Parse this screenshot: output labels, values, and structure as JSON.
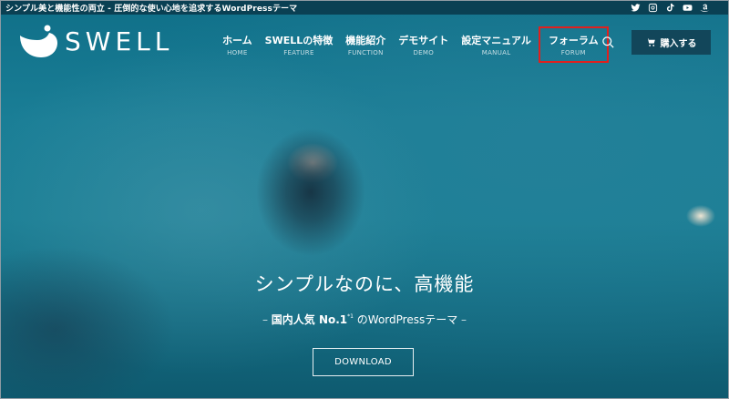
{
  "topbar": {
    "tagline": "シンプル美と機能性の両立 - 圧倒的な使い心地を追求するWordPressテーマ",
    "socials": [
      "twitter-icon",
      "instagram-icon",
      "tiktok-icon",
      "youtube-icon",
      "amazon-icon"
    ]
  },
  "header": {
    "logo_text": "SWELL",
    "nav": [
      {
        "jp": "ホーム",
        "en": "HOME"
      },
      {
        "jp": "SWELLの特徴",
        "en": "FEATURE"
      },
      {
        "jp": "機能紹介",
        "en": "FUNCTION"
      },
      {
        "jp": "デモサイト",
        "en": "DEMO"
      },
      {
        "jp": "設定マニュアル",
        "en": "MANUAL"
      },
      {
        "jp": "フォーラム",
        "en": "FORUM"
      }
    ],
    "buy_label": "購入する"
  },
  "hero": {
    "title": "シンプルなのに、高機能",
    "sub_dash_left": "–",
    "sub_strong": "国内人気 No.1",
    "sub_sup": "*1",
    "sub_rest": " のWordPressテーマ ",
    "sub_dash_right": "–",
    "download_label": "DOWNLOAD"
  },
  "colors": {
    "topbar_bg": "#0a3c4e",
    "buy_button_bg": "#12465a",
    "highlight_outline": "#e0201e"
  }
}
